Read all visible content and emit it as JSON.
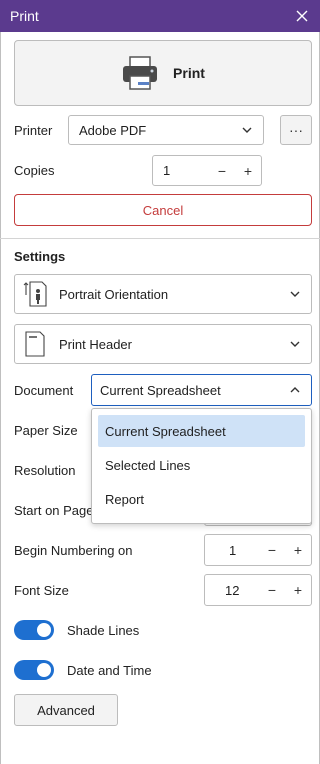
{
  "window": {
    "title": "Print"
  },
  "print_button": {
    "label": "Print"
  },
  "printer": {
    "label": "Printer",
    "selected": "Adobe PDF",
    "more_label": "···"
  },
  "copies": {
    "label": "Copies",
    "value": "1",
    "minus": "−",
    "plus": "+"
  },
  "cancel": {
    "label": "Cancel"
  },
  "settings": {
    "title": "Settings",
    "orientation": "Portrait Orientation",
    "header": "Print Header"
  },
  "document": {
    "label": "Document",
    "selected": "Current Spreadsheet",
    "options": [
      "Current Spreadsheet",
      "Selected Lines",
      "Report"
    ]
  },
  "paper_size": {
    "label": "Paper Size"
  },
  "resolution": {
    "label": "Resolution"
  },
  "start_on_page": {
    "label": "Start on Page"
  },
  "begin_numbering": {
    "label": "Begin Numbering on",
    "value": "1",
    "minus": "−",
    "plus": "+"
  },
  "font_size": {
    "label": "Font Size",
    "value": "12",
    "minus": "−",
    "plus": "+"
  },
  "shade_lines": {
    "label": "Shade Lines",
    "on": true
  },
  "date_time": {
    "label": "Date and Time",
    "on": true
  },
  "advanced": {
    "label": "Advanced"
  },
  "colors": {
    "titlebar": "#5b3a8e",
    "accent": "#1e6fd0",
    "danger": "#c43c3c",
    "selection": "#cfe2f7"
  }
}
